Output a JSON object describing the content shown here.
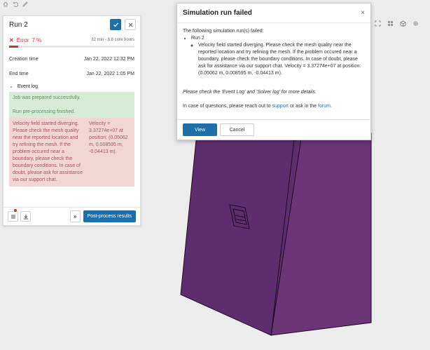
{
  "colors": {
    "accent": "#1e6ea7",
    "error": "#c0392b",
    "model_front": "#5e2d6d",
    "model_side": "#6b3577",
    "log_ok_bg": "#d7ecd7",
    "log_err_bg": "#f2d5d5"
  },
  "run_panel": {
    "title": "Run 2",
    "status_label": "Error",
    "status_percent": "7 %",
    "progress_fraction": 0.07,
    "duration": "32 min - 8.8 core hours",
    "creation_label": "Creation time",
    "creation_value": "Jan 22, 2022 12:32 PM",
    "end_label": "End time",
    "end_value": "Jan 22, 2022 1:05 PM",
    "event_log_label": "Event log",
    "log_ok_1": "Job was prepared successfully.",
    "log_ok_2": "Run pre-processing finished.",
    "log_err_msg": "Velocity field started diverging. Please check the mesh quality near the reported location and try refining the mesh. If the problem occured near a boundary, please check the boundary conditions. In case of doubt, please ask for assistance via our support chat.",
    "log_err_val": "Velocity = 3.37274e+07 at position: (0.05062 m, 0.008595 m, -0.04413 m).",
    "post_process_label": "Post-process results",
    "expand_label": "»"
  },
  "modal": {
    "title": "Simulation run failed",
    "close_glyph": "×",
    "intro": "The following simulation run(s) failed:",
    "run_name": "Run 2",
    "run_detail": "Velocity field started diverging. Please check the mesh quality near the reported location and try refining the mesh. If the problem occured near a boundary, please check the boundary conditions. In case of doubt, please ask for assistance via our support chat. Velocity = 3.37274e+07 at position: (0.05062 m, 0.008595 m, -0.04413 m).",
    "note": "Please check the 'Event Log' and 'Solver log' for more details.",
    "help_prefix": "In case of questions, please reach out to ",
    "support_link": "support",
    "help_middle": " or ask in the ",
    "forum_link": "forum",
    "help_suffix": ".",
    "view_button": "View",
    "cancel_button": "Cancel"
  },
  "icons": {
    "top": [
      "home-icon",
      "undo-icon",
      "edit-icon"
    ],
    "view": [
      "frame-icon",
      "grid-icon",
      "view-cube-icon",
      "settings-icon"
    ]
  }
}
